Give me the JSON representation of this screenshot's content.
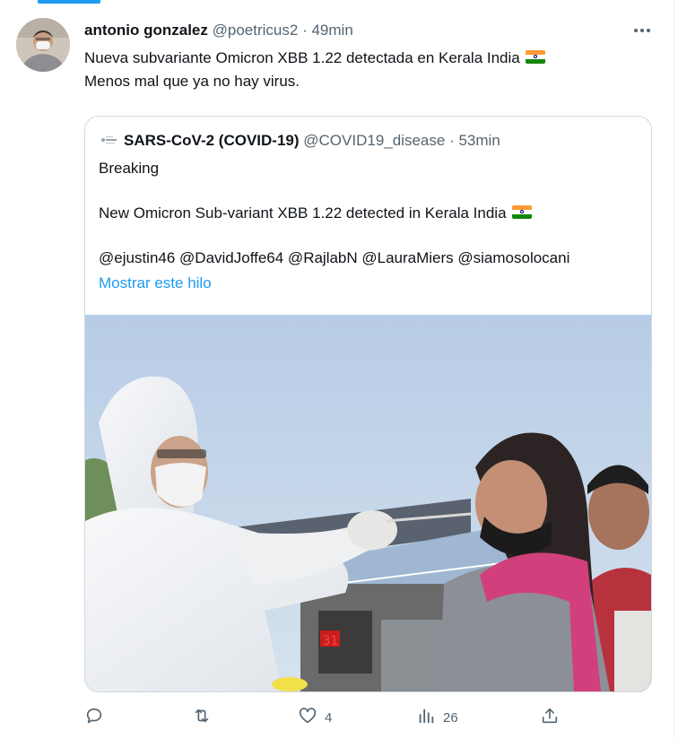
{
  "tweet": {
    "author": {
      "display_name": "antonio gonzalez",
      "handle": "@poetricus2",
      "separator": "·",
      "time": "49min"
    },
    "more_icon": "more-horizontal-icon",
    "text_line1": "Nueva subvariante Omicron XBB 1.22 detectada en Kerala India",
    "text_line2": "Menos mal que ya no hay virus.",
    "flag_icon": "india-flag-icon"
  },
  "quote": {
    "author": {
      "display_name": "SARS-CoV-2 (COVID-19)",
      "handle": "@COVID19_disease",
      "separator": "·",
      "time": "53min"
    },
    "line1": "Breaking",
    "line2": "New Omicron Sub-variant XBB 1.22 detected in Kerala India",
    "mentions": "@ejustin46 @DavidJoffe64 @RajlabN @LauraMiers @siamosolocani",
    "show_thread": "Mostrar este hilo",
    "image_description": "health-worker-swab-test-photo"
  },
  "actions": {
    "reply_icon": "reply-icon",
    "retweet_icon": "retweet-icon",
    "like_icon": "heart-icon",
    "like_count": "4",
    "views_icon": "analytics-icon",
    "views_count": "26",
    "share_icon": "share-icon"
  },
  "colors": {
    "accent": "#1d9bf0",
    "text": "#0f1419",
    "secondary": "#536471",
    "border": "#cfd9de"
  }
}
